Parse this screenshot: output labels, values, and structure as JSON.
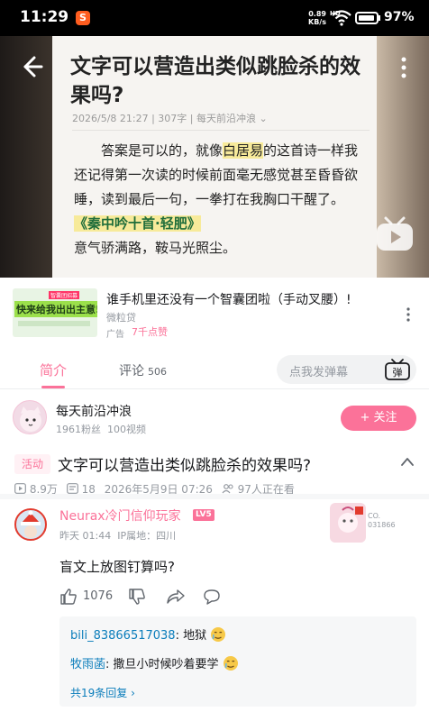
{
  "status_bar": {
    "time": "11:29",
    "app_icon_glyph": "S",
    "net_speed_value": "0.89",
    "net_speed_unit": "KB/s",
    "network_type": "HD",
    "battery_percent": "97%",
    "battery_level": 0.97
  },
  "video_frame": {
    "article_title": "文字可以营造出类似跳脸杀的效果吗?",
    "article_meta": "2026/5/8 21:27 | 307字 | 每天前沿冲浪 ⌄",
    "para_1_part_a": "答案是可以的，就像",
    "para_1_highlight": "白居易",
    "para_1_part_b": "的这首诗一样我还记得第一次读的时候前面毫无感觉甚至昏昏欲睡，读到最后一句，一拳打在我胸口干醒了。",
    "poem_title": "《秦中吟十首·轻肥》",
    "poem_line": "意气骄满路，鞍马光照尘。"
  },
  "ad": {
    "thumb_text": "快来给我出出主意!",
    "thumb_tag": "智囊团招募",
    "title": "谁手机里还没有一个智囊团啦（手动叉腰）!",
    "advertiser": "微粒贷",
    "tag": "广告",
    "likes": "7千点赞"
  },
  "tabs": {
    "intro": "简介",
    "comments": "评论",
    "comment_count": "506",
    "danmu_placeholder": "点我发弹幕",
    "danmu_button_glyph": "弹"
  },
  "uploader": {
    "name": "每天前沿冲浪",
    "fans": "1961粉丝",
    "videos": "100视频",
    "follow_label": "+ 关注"
  },
  "video_info": {
    "badge": "活动",
    "title": "文字可以营造出类似跳脸杀的效果吗?",
    "views": "8.9万",
    "danmaku": "18",
    "date": "2026年5月9日 07:26",
    "watching": "97人正在看"
  },
  "comment": {
    "user": "Neurax冷门信仰玩家",
    "level": "LV5",
    "time": "昨天 01:44",
    "ip": "IP属地：四川",
    "fan_badge_no_1": "CO.",
    "fan_badge_no_2": "031866",
    "text": "盲文上放图钉算吗?",
    "likes": "1076",
    "replies": [
      {
        "user": "bili_83866517038",
        "text": ": 地狱"
      },
      {
        "user": "牧雨菡",
        "text": ": 撒旦小时候吵着要学"
      }
    ],
    "more_replies": "共19条回复 ›"
  },
  "colors": {
    "accent_pink": "#fb7299",
    "link_blue": "#0b7dbb",
    "highlight_yellow": "#f7ea9a"
  }
}
